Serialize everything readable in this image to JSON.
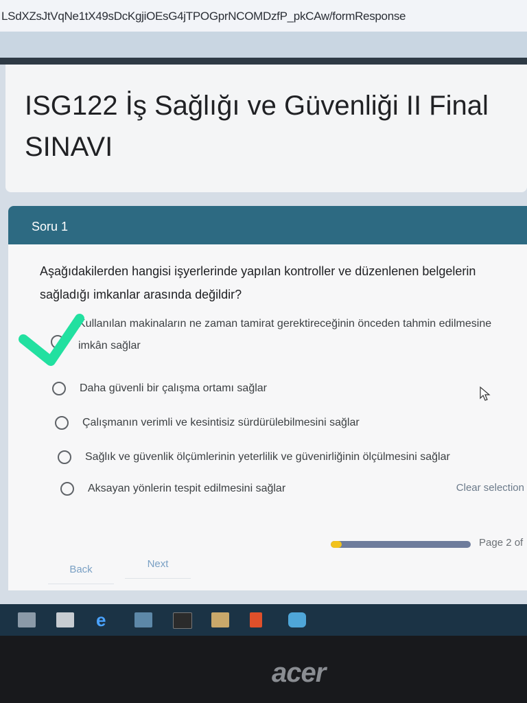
{
  "browser": {
    "url": "LSdXZsJtVqNe1tX49sDcKgjiOEsG4jTPOGprNCOMDzfP_pkCAw/formResponse"
  },
  "form": {
    "title": "ISG122 İş Sağlığı ve Güvenliği II Final SINAVI"
  },
  "question": {
    "header": "Soru 1",
    "text": "Aşağıdakilerden hangisi işyerlerinde yapılan kontroller ve düzenlenen belgelerin sağladığı imkanlar arasında değildir?",
    "options": [
      {
        "line1": "Kullanılan makinaların ne zaman tamirat gerektireceğinin önceden tahmin edilmesine",
        "line2": "imkân sağlar"
      },
      {
        "line1": "Daha güvenli bir çalışma ortamı sağlar"
      },
      {
        "line1": "Çalışmanın verimli ve kesintisiz sürdürülebilmesini sağlar"
      },
      {
        "line1": "Sağlık ve güvenlik ölçümlerinin yeterlilik ve güvenirliğinin ölçülmesini sağlar"
      },
      {
        "line1": "Aksayan yönlerin tespit edilmesini sağlar"
      }
    ],
    "clear_selection": "Clear selection"
  },
  "footer": {
    "back_label": "Back",
    "next_label": "Next",
    "page_label": "Page 2 of",
    "progress_fraction": 0.08
  },
  "annotation": {
    "checkmark_color": "#22e0a0"
  },
  "taskbar": {
    "icons": [
      "file-explorer-icon",
      "folder-icon",
      "internet-explorer-icon",
      "weather-icon",
      "photo-app-icon",
      "store-icon",
      "office-icon",
      "meeting-app-icon"
    ]
  },
  "laptop": {
    "brand": "acer"
  },
  "colors": {
    "header_bg": "#2d6a82",
    "progress_fill": "#f2c21c",
    "progress_track": "#6e7c9c"
  }
}
